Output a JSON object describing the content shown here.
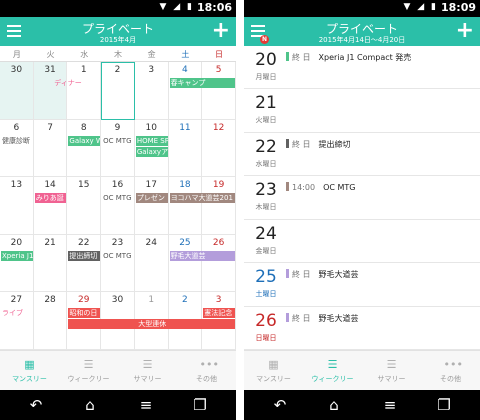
{
  "left": {
    "status": {
      "time": "18:06"
    },
    "header": {
      "title": "プライベート",
      "subtitle": "2015年4月"
    },
    "weekdays": [
      "月",
      "火",
      "水",
      "木",
      "金",
      "土",
      "日"
    ],
    "weeks": [
      [
        "30",
        "31",
        "1",
        "2",
        "3",
        "4",
        "5"
      ],
      [
        "6",
        "7",
        "8",
        "9",
        "10",
        "11",
        "12"
      ],
      [
        "13",
        "14",
        "15",
        "16",
        "17",
        "18",
        "19"
      ],
      [
        "20",
        "21",
        "22",
        "23",
        "24",
        "25",
        "26"
      ],
      [
        "27",
        "28",
        "29",
        "30",
        "1",
        "2",
        "3"
      ]
    ],
    "events": {
      "dinner": "ディナー",
      "spring_camp": "春キャンプ",
      "health_check": "健康診断",
      "galaxy_w": "Galaxy W",
      "oc_mtg_1": "OC MTG",
      "home_sp": "HOME SP",
      "galaxy_a": "Galaxyア",
      "miriam": "みりあ誕",
      "oc_mtg_2": "OC MTG",
      "presen": "プレゼン",
      "yokohama": "ヨコハマ大道芸201",
      "xperia": "Xperia J1",
      "deadline": "提出締切",
      "oc_mtg_3": "OC MTG",
      "nogemi": "野毛大道芸",
      "live": "ライブ",
      "showa": "昭和の日",
      "holidays": "大型連休",
      "constitution": "憲法記念"
    },
    "tabs": [
      "マンスリー",
      "ウィークリー",
      "サマリー",
      "その他"
    ]
  },
  "right": {
    "status": {
      "time": "18:09"
    },
    "header": {
      "title": "プライベート",
      "subtitle": "2015年4月14日～4月20日"
    },
    "days": [
      {
        "num": "20",
        "wd": "月曜日",
        "ev_label": "終 日",
        "ev_title": "Xperia J1 Compact 発売"
      },
      {
        "num": "21",
        "wd": "火曜日",
        "ev_label": "",
        "ev_title": ""
      },
      {
        "num": "22",
        "wd": "水曜日",
        "ev_label": "終 日",
        "ev_title": "提出締切"
      },
      {
        "num": "23",
        "wd": "木曜日",
        "ev_label": "14:00",
        "ev_title": "OC MTG"
      },
      {
        "num": "24",
        "wd": "金曜日",
        "ev_label": "",
        "ev_title": ""
      },
      {
        "num": "25",
        "wd": "土曜日",
        "ev_label": "終 日",
        "ev_title": "野毛大道芸"
      },
      {
        "num": "26",
        "wd": "日曜日",
        "ev_label": "終 日",
        "ev_title": "野毛大道芸"
      }
    ],
    "badge": "N",
    "tabs": [
      "マンスリー",
      "ウィークリー",
      "サマリー",
      "その他"
    ]
  },
  "colors": {
    "accent": "#2bbfa8",
    "green_event": "#4fc48a",
    "pink_event": "#f06292",
    "brown_event": "#a1887f",
    "purple_event": "#b39ddb",
    "gray_event": "#616161",
    "red_event": "#ef5350",
    "saturday": "#1e6fb8",
    "sunday": "#c62828"
  }
}
